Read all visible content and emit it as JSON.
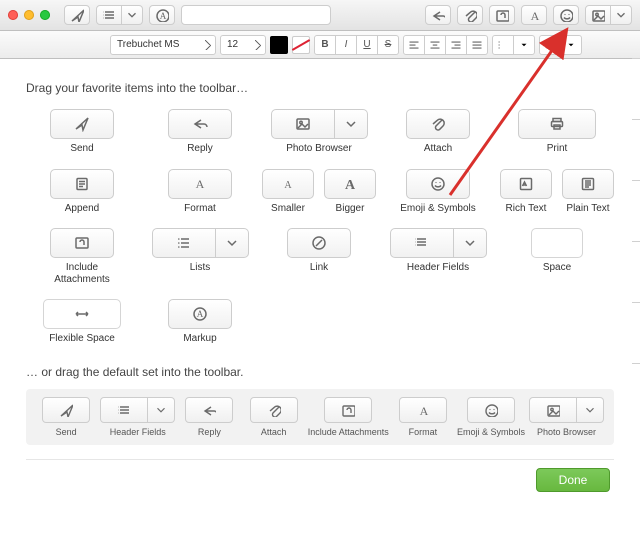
{
  "toolbar": {
    "icons": [
      "send",
      "header-fields",
      "markup",
      "reply",
      "attach",
      "include-attachments",
      "format",
      "emoji",
      "photo-browser"
    ]
  },
  "formatbar": {
    "font": "Trebuchet MS",
    "size": "12",
    "style_bold": "B",
    "style_italic": "I",
    "style_underline": "U",
    "style_strike": "S"
  },
  "palette": {
    "instruction": "Drag your favorite items into the toolbar…",
    "items": [
      {
        "key": "send",
        "label": "Send"
      },
      {
        "key": "reply",
        "label": "Reply"
      },
      {
        "key": "photo-browser",
        "label": "Photo Browser"
      },
      {
        "key": "attach",
        "label": "Attach"
      },
      {
        "key": "print",
        "label": "Print"
      },
      {
        "key": "append",
        "label": "Append"
      },
      {
        "key": "format",
        "label": "Format"
      },
      {
        "key": "smaller",
        "label": "Smaller"
      },
      {
        "key": "bigger",
        "label": "Bigger"
      },
      {
        "key": "emoji",
        "label": "Emoji & Symbols"
      },
      {
        "key": "rich-text",
        "label": "Rich Text"
      },
      {
        "key": "plain-text",
        "label": "Plain Text"
      },
      {
        "key": "include-attachments",
        "label": "Include\nAttachments"
      },
      {
        "key": "lists",
        "label": "Lists"
      },
      {
        "key": "link",
        "label": "Link"
      },
      {
        "key": "header-fields",
        "label": "Header Fields"
      },
      {
        "key": "space",
        "label": "Space"
      },
      {
        "key": "flexible-space",
        "label": "Flexible Space"
      },
      {
        "key": "markup",
        "label": "Markup"
      }
    ],
    "default_instruction": "… or drag the default set into the toolbar.",
    "default_set": [
      {
        "key": "send",
        "label": "Send"
      },
      {
        "key": "header-fields",
        "label": "Header Fields"
      },
      {
        "key": "reply",
        "label": "Reply"
      },
      {
        "key": "attach",
        "label": "Attach"
      },
      {
        "key": "include-attachments",
        "label": "Include Attachments"
      },
      {
        "key": "format",
        "label": "Format"
      },
      {
        "key": "emoji",
        "label": "Emoji & Symbols"
      },
      {
        "key": "photo-browser",
        "label": "Photo Browser"
      }
    ]
  },
  "footer": {
    "done": "Done"
  },
  "colors": {
    "arrow": "#d9302c"
  }
}
